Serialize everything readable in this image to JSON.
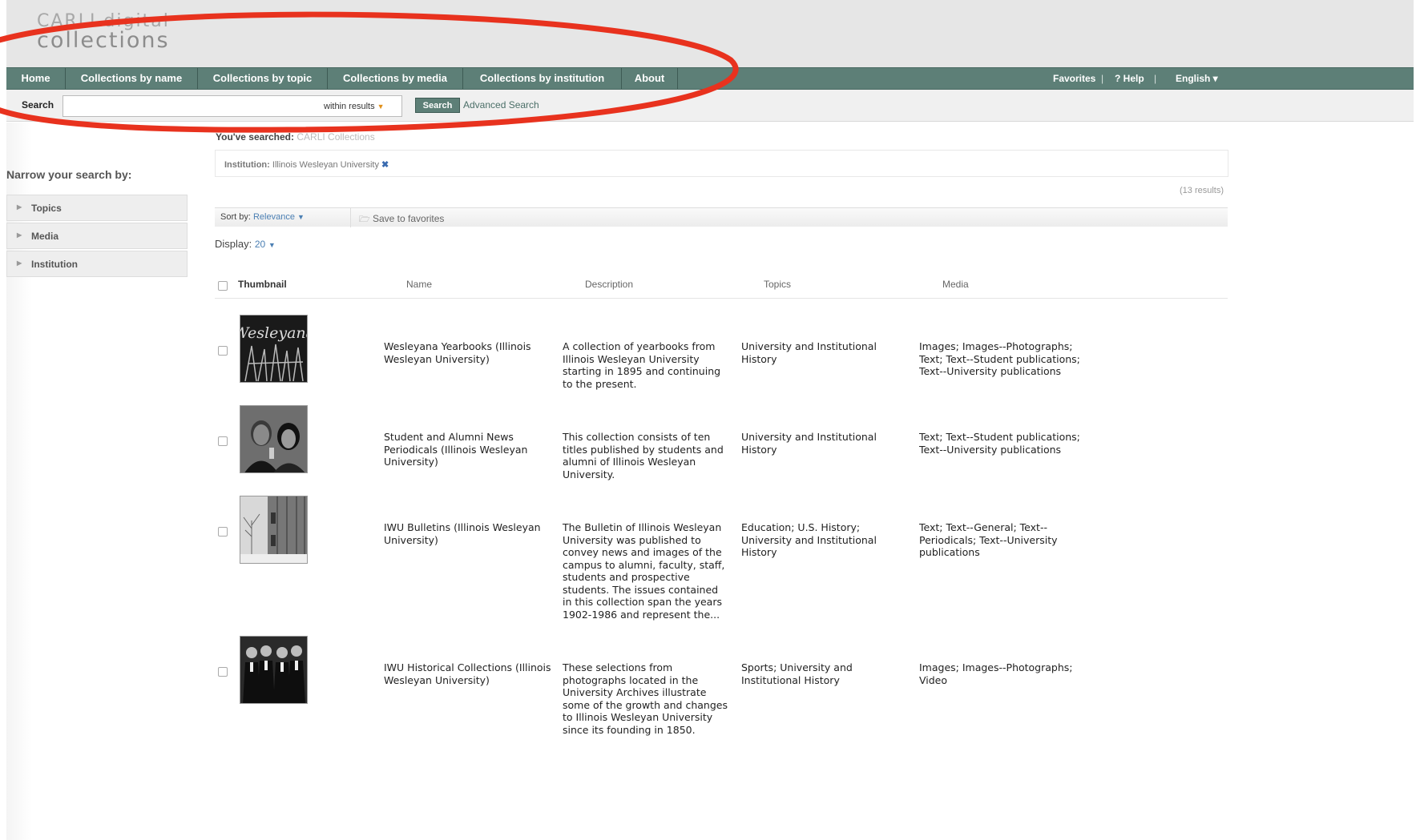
{
  "logo": {
    "line1": "CARLI digital",
    "line2": "collections"
  },
  "nav": {
    "items": [
      "Home",
      "Collections by name",
      "Collections by topic",
      "Collections by media",
      "Collections by institution",
      "About"
    ],
    "favorites": "Favorites",
    "help": "? Help",
    "language": "English ▾"
  },
  "search": {
    "label": "Search",
    "within": "within results",
    "button": "Search",
    "advanced": "Advanced Search"
  },
  "sidebar": {
    "heading": "Narrow your search by:",
    "facets": [
      "Topics",
      "Media",
      "Institution"
    ]
  },
  "query": {
    "searched_label": "You've searched:",
    "searched_value": "CARLI Collections",
    "filter_label": "Institution:",
    "filter_value": "Illinois Wesleyan University",
    "results": "(13 results)"
  },
  "toolbar": {
    "sort_label": "Sort by:",
    "sort_value": "Relevance",
    "save": "Save to favorites",
    "display_label": "Display:",
    "display_value": "20"
  },
  "table": {
    "headers": [
      "Thumbnail",
      "Name",
      "Description",
      "Topics",
      "Media"
    ],
    "rows": [
      {
        "name": "Wesleyana Yearbooks (Illinois Wesleyan University)",
        "description": "A collection of yearbooks from Illinois Wesleyan University starting in 1895 and continuing to the present.",
        "topics": "University and Institutional History",
        "media": "Images; Images--Photographs; Text; Text--Student publications; Text--University publications"
      },
      {
        "name": "Student and Alumni News Periodicals (Illinois Wesleyan University)",
        "description": "This collection consists of ten titles published by students and alumni of Illinois Wesleyan University.",
        "topics": "University and Institutional History",
        "media": "Text; Text--Student publications; Text--University publications"
      },
      {
        "name": "IWU Bulletins (Illinois Wesleyan University)",
        "description": "The Bulletin of Illinois Wesleyan University was published to convey news and images of the campus to alumni, faculty, staff, students and prospective students. The issues contained in this collection span the years 1902-1986 and represent the...",
        "topics": "Education; U.S. History; University and Institutional History",
        "media": "Text; Text--General; Text--Periodicals; Text--University publications"
      },
      {
        "name": "IWU Historical Collections (Illinois Wesleyan University)",
        "description": "These selections from photographs located in the University Archives illustrate some of the growth and changes to Illinois Wesleyan University since its founding in 1850.",
        "topics": "Sports; University and Institutional History",
        "media": "Images; Images--Photographs; Video"
      }
    ]
  },
  "colors": {
    "nav": "#5d7f77",
    "annotation": "#e8321e",
    "link": "#4b7fb3"
  }
}
